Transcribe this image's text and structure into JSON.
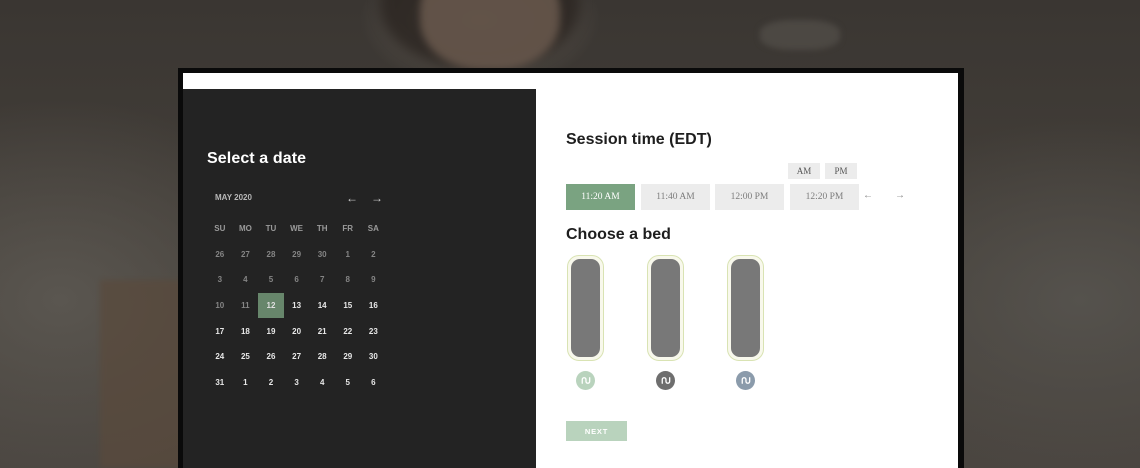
{
  "date_panel": {
    "title": "Select a date",
    "month_label": "MAY 2020",
    "prev_arrow": "←",
    "next_arrow": "→",
    "weekdays": [
      "SU",
      "MO",
      "TU",
      "WE",
      "TH",
      "FR",
      "SA"
    ],
    "selected_day": "12",
    "weeks": [
      [
        {
          "d": "26",
          "s": "muted"
        },
        {
          "d": "27",
          "s": "muted"
        },
        {
          "d": "28",
          "s": "muted"
        },
        {
          "d": "29",
          "s": "muted"
        },
        {
          "d": "30",
          "s": "muted"
        },
        {
          "d": "1",
          "s": "muted"
        },
        {
          "d": "2",
          "s": "muted"
        }
      ],
      [
        {
          "d": "3",
          "s": "muted"
        },
        {
          "d": "4",
          "s": "muted"
        },
        {
          "d": "5",
          "s": "muted"
        },
        {
          "d": "6",
          "s": "muted"
        },
        {
          "d": "7",
          "s": "muted"
        },
        {
          "d": "8",
          "s": "muted"
        },
        {
          "d": "9",
          "s": "muted"
        }
      ],
      [
        {
          "d": "10",
          "s": "muted"
        },
        {
          "d": "11",
          "s": "muted"
        },
        {
          "d": "12",
          "s": "selected"
        },
        {
          "d": "13",
          "s": "active"
        },
        {
          "d": "14",
          "s": "active"
        },
        {
          "d": "15",
          "s": "active"
        },
        {
          "d": "16",
          "s": "active"
        }
      ],
      [
        {
          "d": "17",
          "s": "active"
        },
        {
          "d": "18",
          "s": "active"
        },
        {
          "d": "19",
          "s": "active"
        },
        {
          "d": "20",
          "s": "active"
        },
        {
          "d": "21",
          "s": "active"
        },
        {
          "d": "22",
          "s": "active"
        },
        {
          "d": "23",
          "s": "active"
        }
      ],
      [
        {
          "d": "24",
          "s": "active"
        },
        {
          "d": "25",
          "s": "active"
        },
        {
          "d": "26",
          "s": "active"
        },
        {
          "d": "27",
          "s": "active"
        },
        {
          "d": "28",
          "s": "active"
        },
        {
          "d": "29",
          "s": "active"
        },
        {
          "d": "30",
          "s": "active"
        }
      ],
      [
        {
          "d": "31",
          "s": "active"
        },
        {
          "d": "1",
          "s": "active"
        },
        {
          "d": "2",
          "s": "active"
        },
        {
          "d": "3",
          "s": "active"
        },
        {
          "d": "4",
          "s": "active"
        },
        {
          "d": "5",
          "s": "active"
        },
        {
          "d": "6",
          "s": "active"
        }
      ]
    ]
  },
  "session": {
    "title": "Session time (EDT)",
    "am_label": "AM",
    "pm_label": "PM",
    "slots": [
      "11:20 AM",
      "11:40 AM",
      "12:00 PM",
      "12:20 PM"
    ],
    "selected_slot": "11:20 AM",
    "prev_arrow": "←",
    "next_arrow": "→"
  },
  "beds": {
    "title": "Choose a bed",
    "icons": [
      {
        "icon": "bed-logo-icon",
        "color": "#b9d3bd"
      },
      {
        "icon": "bed-logo-icon",
        "color": "#6e6e6e"
      },
      {
        "icon": "bed-logo-icon",
        "color": "#8b9bab"
      }
    ]
  },
  "next_button": "NEXT",
  "colors": {
    "accent_green": "#7aa381",
    "selected_day_bg": "#67866b",
    "dark_panel": "#232323",
    "next_button_bg": "#b9d3bd"
  }
}
